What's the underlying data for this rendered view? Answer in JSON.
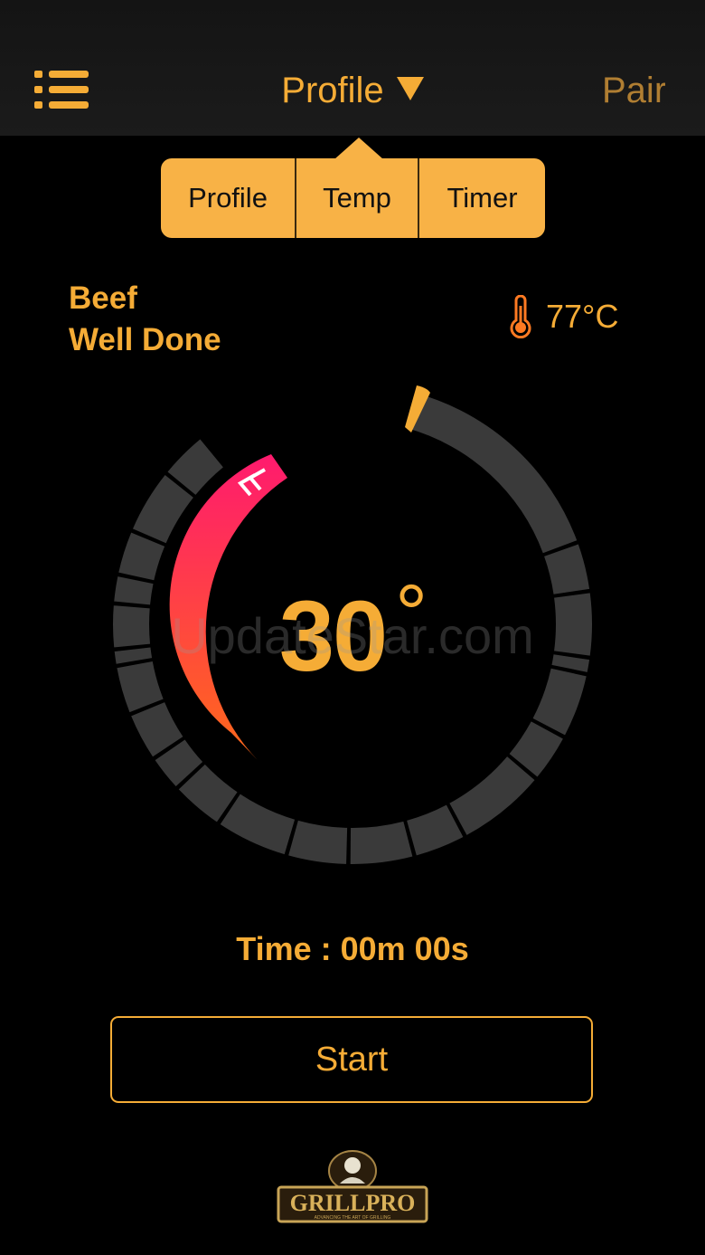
{
  "header": {
    "title": "Profile",
    "right_label": "Pair",
    "menu_icon": "list-menu-icon",
    "caret_icon": "caret-down-icon"
  },
  "segmented": {
    "options": [
      "Profile",
      "Temp",
      "Timer"
    ],
    "selected": "Profile"
  },
  "profile": {
    "meat": "Beef",
    "doneness": "Well Done"
  },
  "target_temp": {
    "icon": "thermometer-icon",
    "value": "77°C"
  },
  "gauge": {
    "current_value": "30",
    "degree_symbol": "°",
    "current_temp_progress": 0.3,
    "colors": {
      "track": "#3a3a3a",
      "accent": "#f5ac36",
      "arc_start": "#ff1a6e",
      "arc_end": "#ff6a1a"
    }
  },
  "watermark": "UpdateStar.com",
  "timer": {
    "label": "Time : 00m 00s"
  },
  "start_button": {
    "label": "Start"
  },
  "brand": {
    "logo_text": "GRILLPRO",
    "tagline": "ADVANCING THE ART OF GRILLING"
  }
}
